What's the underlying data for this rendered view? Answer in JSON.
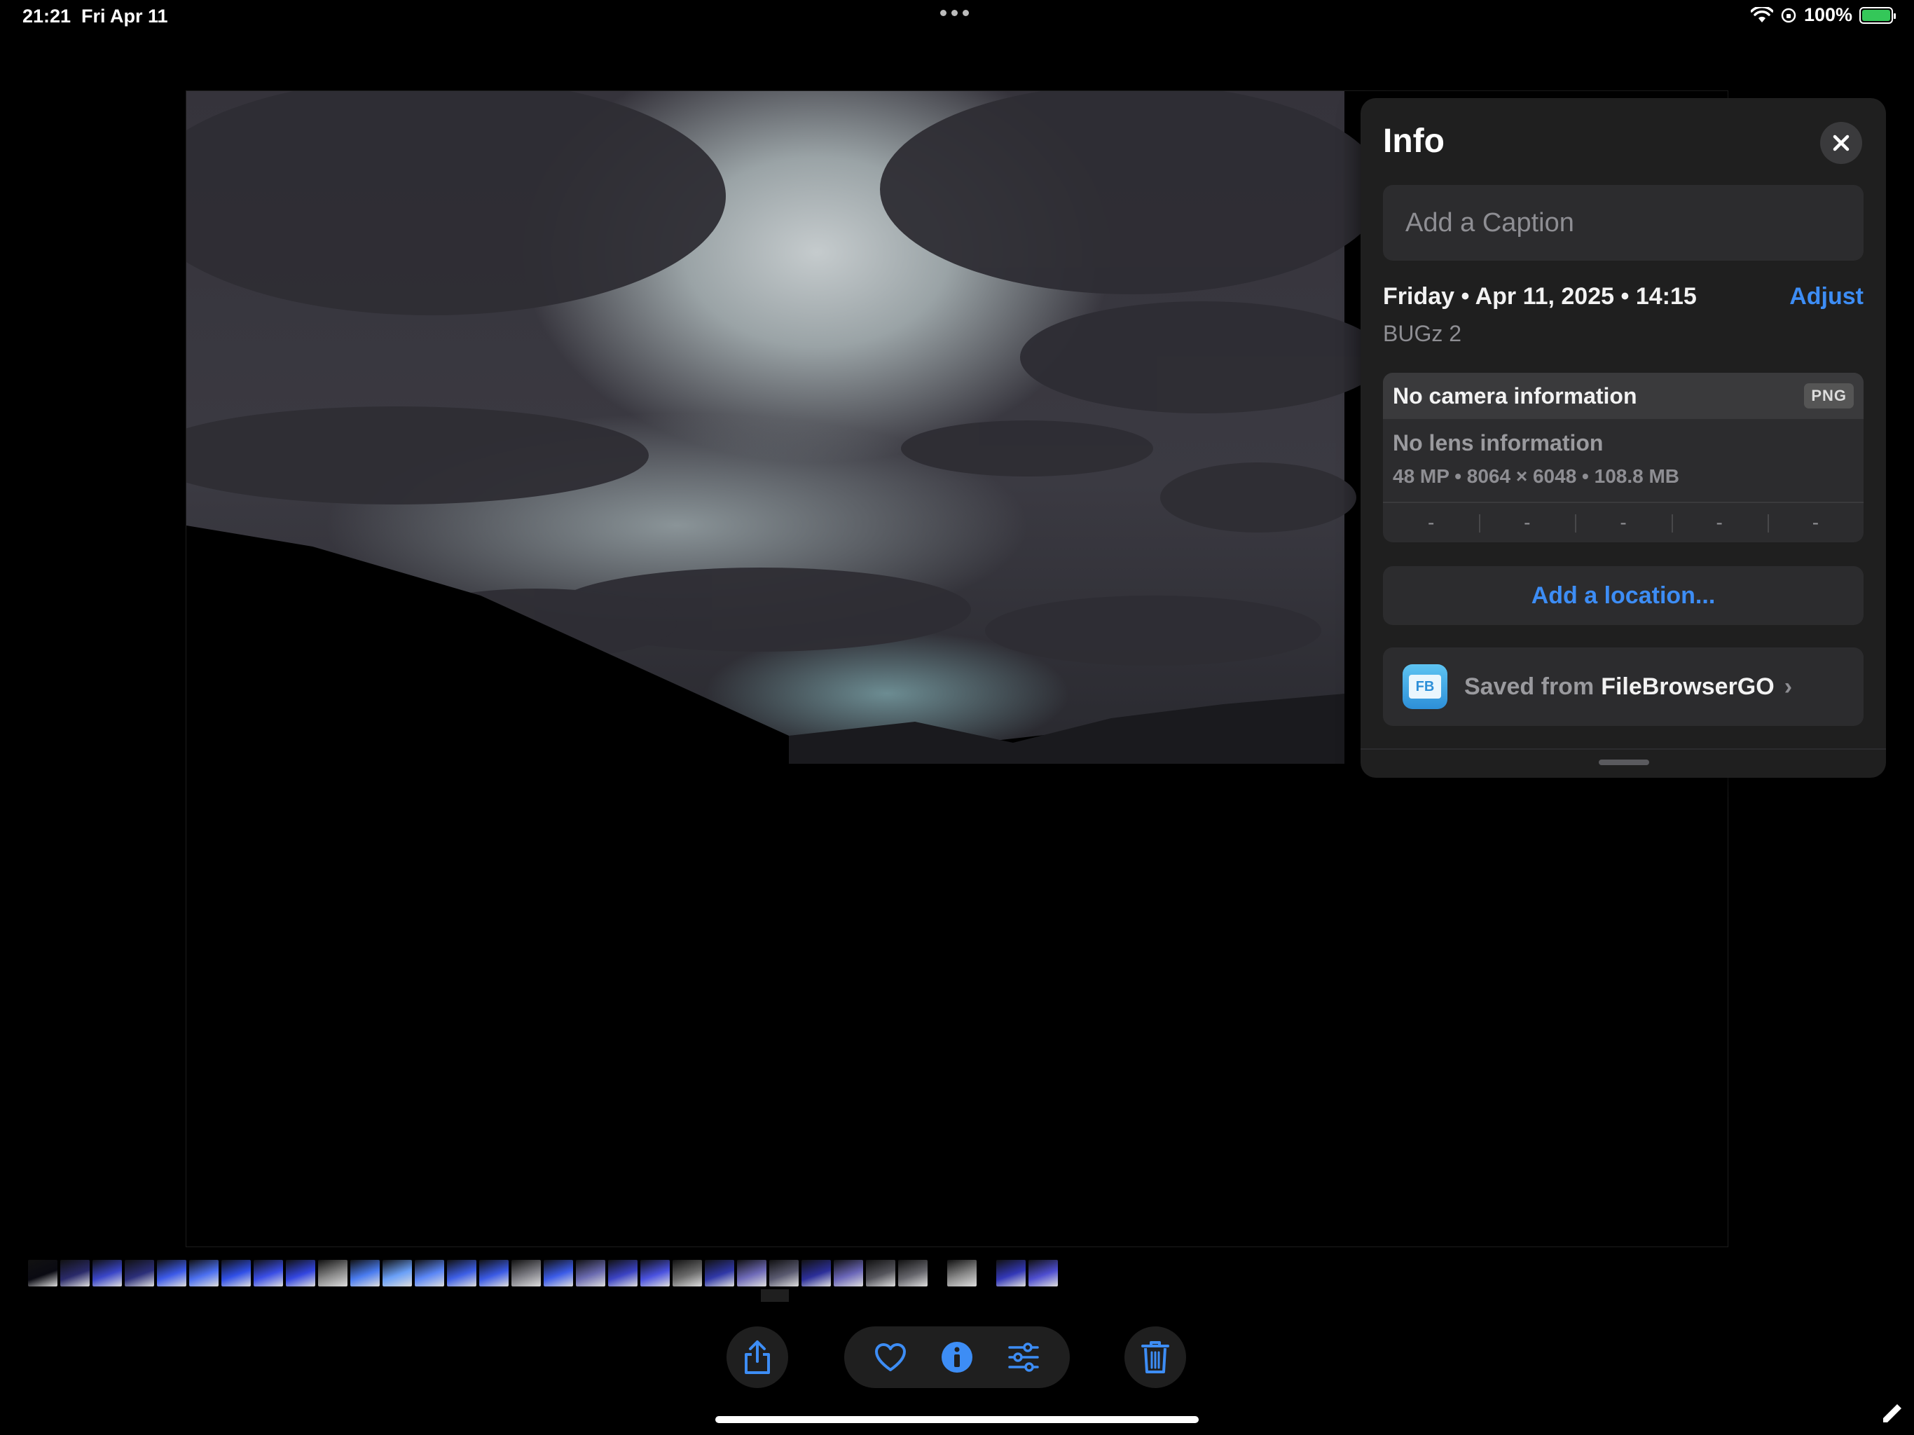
{
  "status_bar": {
    "time": "21:21",
    "date": "Fri Apr 11",
    "battery": "100%",
    "battery_fill": 1.0
  },
  "info_panel": {
    "title": "Info",
    "caption_placeholder": "Add a Caption",
    "date_line": "Friday • Apr 11, 2025 • 14:15",
    "adjust_label": "Adjust",
    "album": "BUGz 2",
    "camera": {
      "title": "No camera information",
      "format": "PNG",
      "lens": "No lens information",
      "specs": "48 MP • 8064 × 6048 • 108.8 MB",
      "exif": [
        "-",
        "-",
        "-",
        "-",
        "-"
      ]
    },
    "location_label": "Add a location...",
    "source": {
      "prefix": "Saved from",
      "app": "FileBrowserGO",
      "app_icon_text": "FB"
    }
  },
  "thumbnails": [
    "#0a0a12",
    "#2a2a6a",
    "#3a46c8",
    "#2c2f7a",
    "#3c5ae8",
    "#4b6ff0",
    "#3050e8",
    "#3a4ee6",
    "#3346e0",
    "#8a8a8a",
    "#4a7cf0",
    "#6aa0f8",
    "#5a86f6",
    "#3d5fe6",
    "#3a5ae4",
    "#7f7f86",
    "#3c5ce8",
    "#6a6ab0",
    "#3b43c4",
    "#4a52e0",
    "#6b6b6b",
    "#3038a8",
    "#6e6ab8",
    "#5a5a70",
    "#2c2f9a",
    "#6a66b8",
    "#55555c",
    "#66666c",
    "#gap",
    "#8a8a8a",
    "#gap",
    "#3338b8",
    "#4e4ed0"
  ],
  "colors": {
    "accent": "#3d8df5",
    "panel_bg": "#1f1f1f",
    "field_bg": "#2c2c2e"
  },
  "icons": {
    "share": "share-icon",
    "favorite": "heart-icon",
    "info": "info-icon",
    "edit": "sliders-icon",
    "delete": "trash-icon"
  }
}
